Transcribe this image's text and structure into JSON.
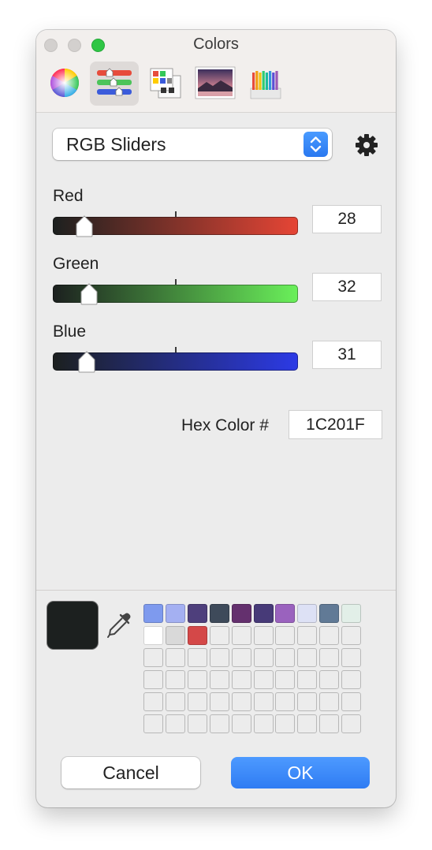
{
  "window": {
    "title": "Colors"
  },
  "toolbar": [
    {
      "name": "color-wheel-tab-button",
      "icon": "color-wheel-icon",
      "selected": false
    },
    {
      "name": "color-sliders-tab-button",
      "icon": "sliders-icon",
      "selected": true
    },
    {
      "name": "color-palettes-tab-button",
      "icon": "palettes-icon",
      "selected": false
    },
    {
      "name": "image-palettes-tab-button",
      "icon": "image-icon",
      "selected": false
    },
    {
      "name": "pencils-tab-button",
      "icon": "pencils-icon",
      "selected": false
    }
  ],
  "mode_popup": {
    "label": "RGB Sliders"
  },
  "sliders": {
    "red": {
      "label": "Red",
      "value": "28",
      "fraction": 0.11,
      "gradient_end": "#e64535"
    },
    "green": {
      "label": "Green",
      "value": "32",
      "fraction": 0.13,
      "gradient_end": "#6af05a"
    },
    "blue": {
      "label": "Blue",
      "value": "31",
      "fraction": 0.12,
      "gradient_end": "#2c3ae6"
    }
  },
  "hex": {
    "label": "Hex Color #",
    "value": "1C201F"
  },
  "current_color": "#1c201f",
  "saved_colors": [
    "#7e9aee",
    "#a4b0f2",
    "#4e3f7c",
    "#3e4a5a",
    "#64306e",
    "#473a78",
    "#9a62be",
    "#dde1f5",
    "#617a96",
    "#e2efe8",
    "#ffffff",
    "#d9d9d9",
    "#d44848"
  ],
  "buttons": {
    "cancel": "Cancel",
    "ok": "OK"
  }
}
